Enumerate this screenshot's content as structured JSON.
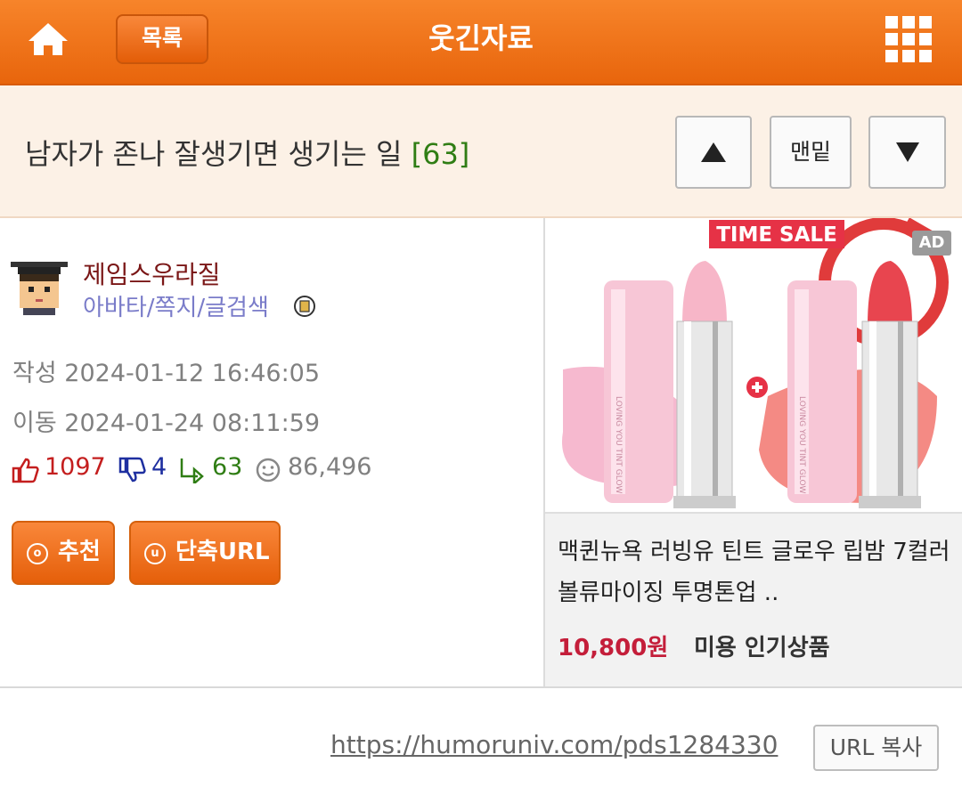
{
  "header": {
    "home_icon": "home-icon",
    "list_label": "목록",
    "board_title": "웃긴자료",
    "menu_icon": "grid-menu-icon"
  },
  "post": {
    "title": "남자가 존나 잘생기면 생기는 일",
    "reply_count": "[63]",
    "nav": {
      "up_icon": "triangle-up-icon",
      "bottom_label": "맨밑",
      "down_icon": "triangle-down-icon"
    }
  },
  "author": {
    "name": "제임스우라질",
    "links": "아바타/쪽지/글검색",
    "created_label": "작성",
    "created": "2024-01-12 16:46:05",
    "moved_label": "이동",
    "moved": "2024-01-24 08:11:59"
  },
  "stats": {
    "likes": "1097",
    "dislikes": "4",
    "replies": "63",
    "views": "86,496"
  },
  "actions": {
    "recommend_label": "추천",
    "shorturl_label": "단축URL"
  },
  "ad": {
    "banner_text": "TIME SALE",
    "mark": "AD",
    "title": "맥퀸뉴욕 러빙유 틴트 글로우 립밤 7컬러 볼류마이징 투명톤업 ..",
    "price": "10,800원",
    "tag": "미용 인기상품"
  },
  "footer": {
    "url": "https://humoruniv.com/pds1284330",
    "copy_label": "URL 복사"
  },
  "colors": {
    "header_orange": "#ee6f14",
    "reply_green": "#2f7d14",
    "like_red": "#c41e1e",
    "dislike_blue": "#1e2fa0",
    "price_red": "#c41e3a"
  }
}
